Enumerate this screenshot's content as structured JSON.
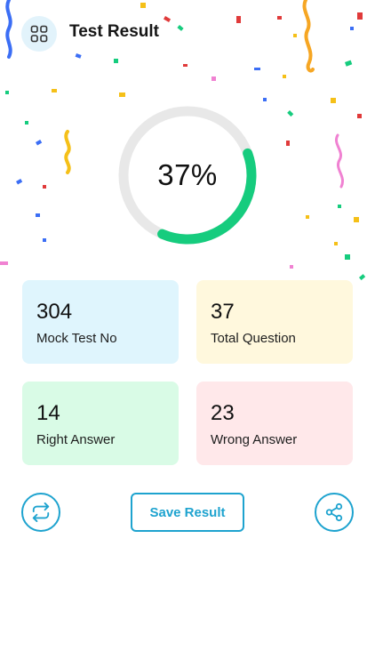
{
  "header": {
    "title": "Test Result",
    "menu_icon": "grid-icon"
  },
  "score": {
    "label": "37%",
    "progress": 0.37,
    "progress_color": "#16cc7e",
    "track_color": "#e8e8e8"
  },
  "stats": [
    {
      "value": "304",
      "label": "Mock Test No",
      "color": "#dff5fd"
    },
    {
      "value": "37",
      "label": "Total Question",
      "color": "#fff8dd"
    },
    {
      "value": "14",
      "label": "Right Answer",
      "color": "#d9fbe6"
    },
    {
      "value": "23",
      "label": "Wrong Answer",
      "color": "#ffe8ea"
    }
  ],
  "actions": {
    "retry_icon": "repeat-icon",
    "save_label": "Save Result",
    "share_icon": "share-icon",
    "accent_color": "#1ea3cf"
  }
}
